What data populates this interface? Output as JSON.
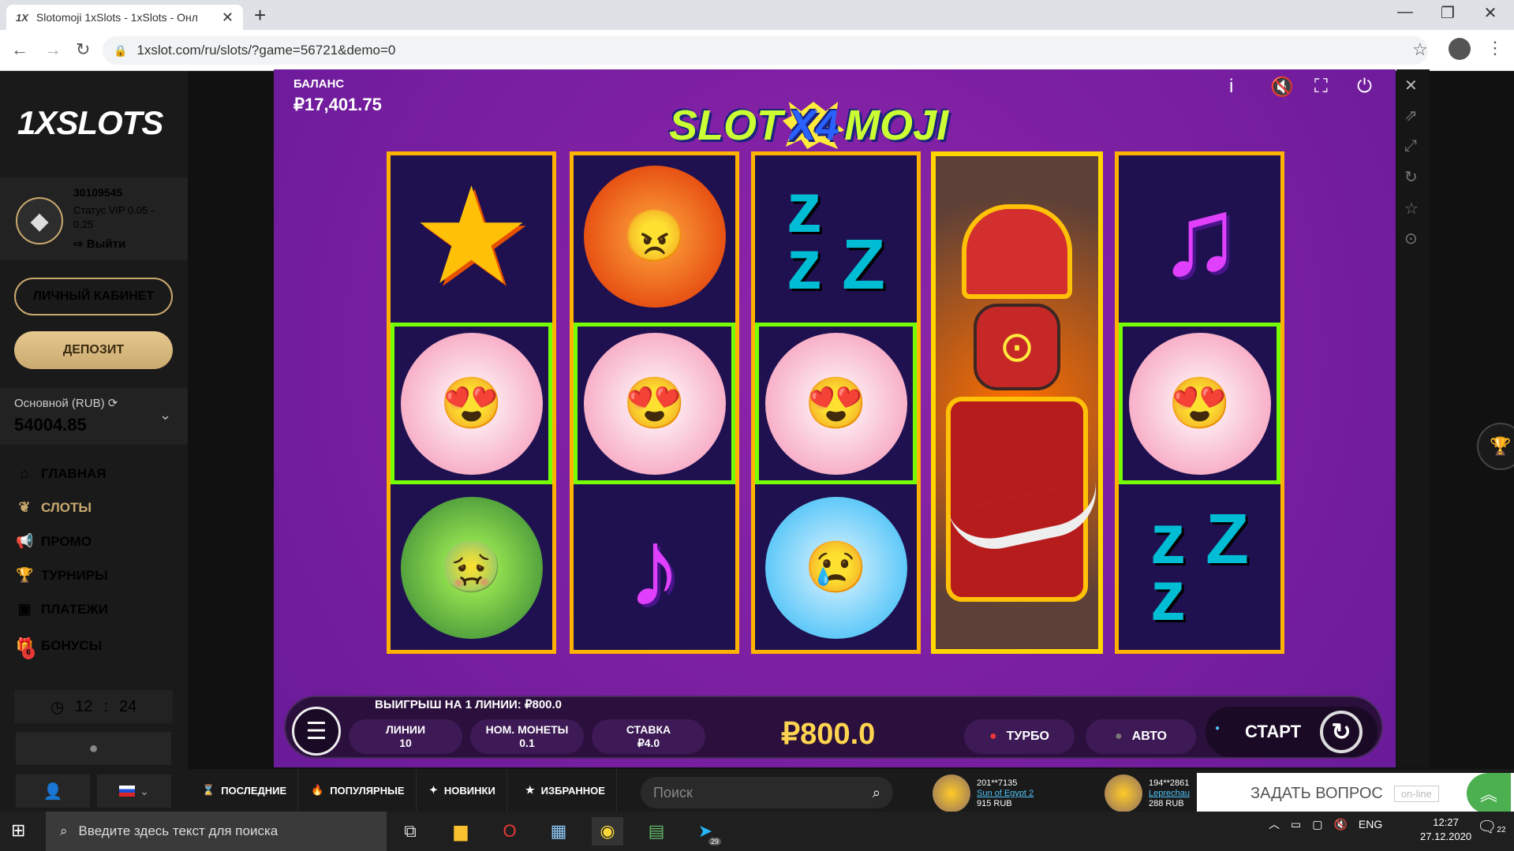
{
  "browser": {
    "tab_title": "Slotomoji 1xSlots - 1xSlots - Онл",
    "tab_favicon": "1X",
    "url": "1xslot.com/ru/slots/?game=56721&demo=0"
  },
  "sidebar": {
    "logo": "1XSLOTS",
    "user_id": "30109545",
    "vip_status": "Статус VIP 0.05 - 0.25",
    "logout": "⇨ Выйти",
    "cabinet_button": "ЛИЧНЫЙ КАБИНЕТ",
    "deposit_button": "ДЕПОЗИТ",
    "balance_label": "Основной (RUB)",
    "balance_value": "54004.85",
    "nav": [
      {
        "label": "ГЛАВНАЯ",
        "icon": "home-icon"
      },
      {
        "label": "СЛОТЫ",
        "icon": "cherry-icon"
      },
      {
        "label": "ПРОМО",
        "icon": "megaphone-icon"
      },
      {
        "label": "ТУРНИРЫ",
        "icon": "trophy-icon"
      },
      {
        "label": "ПЛАТЕЖИ",
        "icon": "wallet-icon"
      },
      {
        "label": "БОНУСЫ",
        "icon": "gift-icon",
        "badge": "6"
      }
    ],
    "clock_h": "12",
    "clock_sep": ":",
    "clock_m": "24"
  },
  "game": {
    "balance_label": "БАЛАНС",
    "balance_value": "₽17,401.75",
    "title_left": "SLOT",
    "title_mid": "X4",
    "title_right": "MOJI",
    "win_line_text": "ВЫИГРЫШ НА 1 ЛИНИИ: ₽800.0",
    "lines_label": "ЛИНИИ",
    "lines_value": "10",
    "coin_label": "НОМ. МОНЕТЫ",
    "coin_value": "0.1",
    "bet_label": "СТАВКА",
    "bet_value": "₽4.0",
    "win_amount": "₽800.0",
    "turbo": "ТУРБО",
    "auto": "АВТО",
    "start": "СТАРТ",
    "colors": {
      "background": "#7b1fa2",
      "reel_border": "#ffb300",
      "win_border": "#76ff03",
      "win_amount": "#ffd54f"
    }
  },
  "bottom_tabs": {
    "recent": "ПОСЛЕДНИЕ",
    "popular": "ПОПУЛЯРНЫЕ",
    "new": "НОВИНКИ",
    "favorites": "ИЗБРАННОЕ",
    "search_placeholder": "Поиск"
  },
  "winners": [
    {
      "user": "201**7135",
      "game": "Sun of Egypt 2",
      "amount": "915 RUB"
    },
    {
      "user": "194**2861",
      "game": "Leprechau",
      "amount": "288 RUB"
    }
  ],
  "support": {
    "ask": "ЗАДАТЬ ВОПРОС",
    "status": "on-line"
  },
  "taskbar": {
    "search_placeholder": "Введите здесь текст для поиска",
    "lang": "ENG",
    "time": "12:27",
    "date": "27.12.2020",
    "notifications": "22",
    "telegram_badge": "29"
  }
}
